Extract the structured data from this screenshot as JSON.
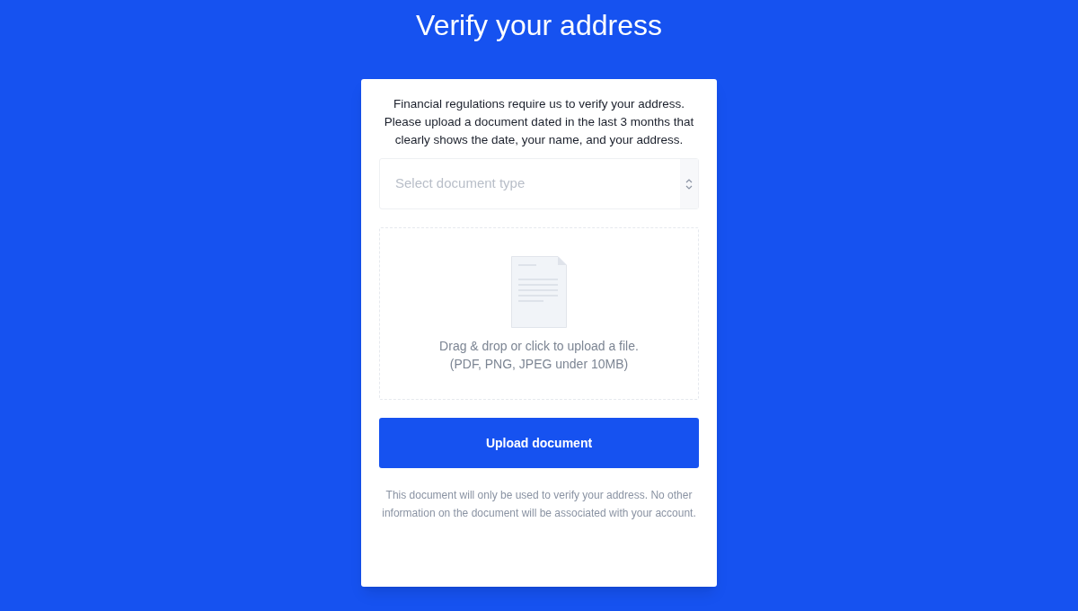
{
  "title": "Verify your address",
  "intro": "Financial regulations require us to verify your address. Please upload a document dated in the last 3 months that clearly shows the date, your name, and your address.",
  "document_select": {
    "placeholder": "Select document type"
  },
  "dropzone": {
    "lines": [
      "Drag & drop or click to upload a file.",
      "(PDF, PNG, JPEG under 10MB)"
    ]
  },
  "button": "Upload document",
  "footnote": "This document will only be used to verify your address. No other information on the document will be associated with your account."
}
